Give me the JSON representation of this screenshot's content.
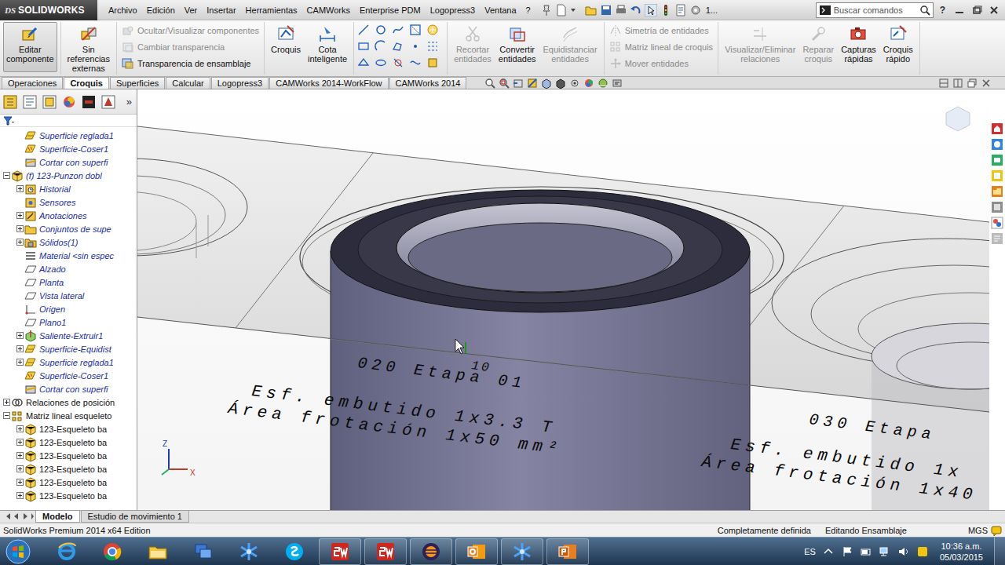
{
  "app": {
    "logo_mark": "DS",
    "logo_text": "SOLIDWORKS"
  },
  "menu": [
    "Archivo",
    "Edición",
    "Ver",
    "Insertar",
    "Herramientas",
    "CAMWorks",
    "Enterprise PDM",
    "Logopress3",
    "Ventana",
    "?"
  ],
  "quick_access": {
    "overflow": "1..."
  },
  "search": {
    "placeholder": "Buscar comandos"
  },
  "help": "?",
  "ribbon": {
    "groups": [
      {
        "kind": "big",
        "items": [
          {
            "label": "Editar componente",
            "disabled": false,
            "selected": true
          }
        ]
      },
      {
        "kind": "big",
        "items": [
          {
            "label": "Sin referencias externas",
            "disabled": false,
            "selected": false
          }
        ]
      },
      {
        "kind": "stack",
        "items": [
          {
            "label": "Ocultar/Visualizar componentes",
            "disabled": true,
            "selected": false
          },
          {
            "label": "Cambiar transparencia",
            "disabled": true,
            "selected": false
          },
          {
            "label": "Transparencia de ensamblaje",
            "disabled": false,
            "selected": false
          }
        ]
      },
      {
        "kind": "big",
        "items": [
          {
            "label": "Croquis",
            "disabled": false,
            "selected": false
          },
          {
            "label": "Cota inteligente",
            "disabled": false,
            "selected": false
          }
        ]
      },
      {
        "kind": "tools",
        "items": []
      },
      {
        "kind": "big",
        "items": [
          {
            "label": "Recortar entidades",
            "disabled": true,
            "selected": false
          },
          {
            "label": "Convertir entidades",
            "disabled": false,
            "selected": false
          },
          {
            "label": "Equidistanciar entidades",
            "disabled": true,
            "selected": false
          }
        ]
      },
      {
        "kind": "stack",
        "items": [
          {
            "label": "Simetría de entidades",
            "disabled": true,
            "selected": false
          },
          {
            "label": "Matriz lineal de croquis",
            "disabled": true,
            "selected": false
          },
          {
            "label": "Mover entidades",
            "disabled": true,
            "selected": false
          }
        ]
      },
      {
        "kind": "big",
        "items": [
          {
            "label": "Visualizar/Eliminar relaciones",
            "disabled": true,
            "selected": false
          },
          {
            "label": "Reparar croquis",
            "disabled": true,
            "selected": false
          },
          {
            "label": "Capturas rápidas",
            "disabled": false,
            "selected": false
          },
          {
            "label": "Croquis rápido",
            "disabled": false,
            "selected": false
          }
        ]
      }
    ]
  },
  "command_tabs": [
    {
      "label": "Operaciones",
      "selected": false
    },
    {
      "label": "Croquis",
      "selected": true
    },
    {
      "label": "Superficies",
      "selected": false
    },
    {
      "label": "Calcular",
      "selected": false
    },
    {
      "label": "Logopress3",
      "selected": false
    },
    {
      "label": "CAMWorks 2014-WorkFlow",
      "selected": false
    },
    {
      "label": "CAMWorks 2014",
      "selected": false
    }
  ],
  "feature_tree": {
    "more": "»",
    "items": [
      {
        "label": "Superficie reglada1",
        "depth": 1,
        "kind": "surface",
        "children": false,
        "expanded": false,
        "color": "#1c2fa8",
        "italic": true
      },
      {
        "label": "Superficie-Coser1",
        "depth": 1,
        "kind": "knit",
        "children": false,
        "expanded": false,
        "color": "#1c2fa8",
        "italic": true
      },
      {
        "label": "Cortar con superfi",
        "depth": 1,
        "kind": "cut",
        "children": false,
        "expanded": false,
        "color": "#1c2fa8",
        "italic": true
      },
      {
        "label": "(f) 123-Punzon dobl",
        "depth": 0,
        "kind": "part",
        "children": true,
        "expanded": true,
        "color": "#1c2fa8",
        "italic": true
      },
      {
        "label": "Historial",
        "depth": 1,
        "kind": "history",
        "children": true,
        "expanded": false,
        "color": "#1c2fa8",
        "italic": true
      },
      {
        "label": "Sensores",
        "depth": 1,
        "kind": "sensor",
        "children": false,
        "expanded": false,
        "color": "#1c2fa8",
        "italic": true
      },
      {
        "label": "Anotaciones",
        "depth": 1,
        "kind": "annotation",
        "children": true,
        "expanded": false,
        "color": "#1c2fa8",
        "italic": true
      },
      {
        "label": "Conjuntos de supe",
        "depth": 1,
        "kind": "folder",
        "children": true,
        "expanded": false,
        "color": "#1c2fa8",
        "italic": true
      },
      {
        "label": "Sólidos(1)",
        "depth": 1,
        "kind": "solids",
        "children": true,
        "expanded": false,
        "color": "#1c2fa8",
        "italic": true
      },
      {
        "label": "Material <sin espec",
        "depth": 1,
        "kind": "material",
        "children": false,
        "expanded": false,
        "color": "#1c2fa8",
        "italic": true
      },
      {
        "label": "Alzado",
        "depth": 1,
        "kind": "plane",
        "children": false,
        "expanded": false,
        "color": "#1c2fa8",
        "italic": true
      },
      {
        "label": "Planta",
        "depth": 1,
        "kind": "plane",
        "children": false,
        "expanded": false,
        "color": "#1c2fa8",
        "italic": true
      },
      {
        "label": "Vista lateral",
        "depth": 1,
        "kind": "plane",
        "children": false,
        "expanded": false,
        "color": "#1c2fa8",
        "italic": true
      },
      {
        "label": "Origen",
        "depth": 1,
        "kind": "origin",
        "children": false,
        "expanded": false,
        "color": "#1c2fa8",
        "italic": true
      },
      {
        "label": "Plano1",
        "depth": 1,
        "kind": "plane",
        "children": false,
        "expanded": false,
        "color": "#1c2fa8",
        "italic": true
      },
      {
        "label": "Saliente-Extruir1",
        "depth": 1,
        "kind": "extrude",
        "children": true,
        "expanded": false,
        "color": "#1c2fa8",
        "italic": true
      },
      {
        "label": "Superficie-Equidist",
        "depth": 1,
        "kind": "surface",
        "children": true,
        "expanded": false,
        "color": "#1c2fa8",
        "italic": true
      },
      {
        "label": "Superficie reglada1",
        "depth": 1,
        "kind": "surface",
        "children": true,
        "expanded": false,
        "color": "#1c2fa8",
        "italic": true
      },
      {
        "label": "Superficie-Coser1",
        "depth": 1,
        "kind": "knit",
        "children": false,
        "expanded": false,
        "color": "#1c2fa8",
        "italic": true
      },
      {
        "label": "Cortar con superfi",
        "depth": 1,
        "kind": "cut",
        "children": false,
        "expanded": false,
        "color": "#1c2fa8",
        "italic": true
      },
      {
        "label": "Relaciones de posición",
        "depth": 0,
        "kind": "mates",
        "children": true,
        "expanded": false,
        "color": "#111111",
        "italic": false
      },
      {
        "label": "Matriz lineal esqueleto",
        "depth": 0,
        "kind": "pattern",
        "children": true,
        "expanded": true,
        "color": "#111111",
        "italic": false
      },
      {
        "label": "123-Esqueleto ba",
        "depth": 1,
        "kind": "part",
        "children": true,
        "expanded": false,
        "color": "#111111",
        "italic": false
      },
      {
        "label": "123-Esqueleto ba",
        "depth": 1,
        "kind": "part",
        "children": true,
        "expanded": false,
        "color": "#111111",
        "italic": false
      },
      {
        "label": "123-Esqueleto ba",
        "depth": 1,
        "kind": "part",
        "children": true,
        "expanded": false,
        "color": "#111111",
        "italic": false
      },
      {
        "label": "123-Esqueleto ba",
        "depth": 1,
        "kind": "part",
        "children": true,
        "expanded": false,
        "color": "#111111",
        "italic": false
      },
      {
        "label": "123-Esqueleto ba",
        "depth": 1,
        "kind": "part",
        "children": true,
        "expanded": false,
        "color": "#111111",
        "italic": false
      },
      {
        "label": "123-Esqueleto ba",
        "depth": 1,
        "kind": "part",
        "children": true,
        "expanded": false,
        "color": "#111111",
        "italic": false
      }
    ]
  },
  "viewport": {
    "annotations": [
      "10",
      "020 Etapa 01",
      "Esf. embutido 1x3.3 T",
      "Área frotación 1x50 mm²",
      "030 Etapa",
      "Esf. embutido 1x",
      "Área frotación 1x40"
    ],
    "triad": {
      "z": "Z",
      "x": "X"
    }
  },
  "bottom_tabs": [
    {
      "label": "Modelo",
      "selected": true
    },
    {
      "label": "Estudio de movimiento 1",
      "selected": false
    }
  ],
  "status_bar": {
    "edition": "SolidWorks Premium 2014 x64 Edition",
    "state": "Completamente definida",
    "mode": "Editando Ensamblaje",
    "units": "MGS"
  },
  "taskbar": {
    "apps": [
      {
        "kind": "ie",
        "open": false
      },
      {
        "kind": "chrome",
        "open": false
      },
      {
        "kind": "explorer",
        "open": false
      },
      {
        "kind": "network",
        "open": false
      },
      {
        "kind": "snowflake",
        "open": false
      },
      {
        "kind": "skype",
        "open": false
      },
      {
        "kind": "solidworks",
        "open": true
      },
      {
        "kind": "solidworks",
        "open": true
      },
      {
        "kind": "eclipse",
        "open": true
      },
      {
        "kind": "outlook",
        "open": true
      },
      {
        "kind": "snowflake",
        "open": true
      },
      {
        "kind": "powerpoint",
        "open": true
      }
    ],
    "language": "ES",
    "time": "10:36 a.m.",
    "date": "05/03/2015"
  }
}
